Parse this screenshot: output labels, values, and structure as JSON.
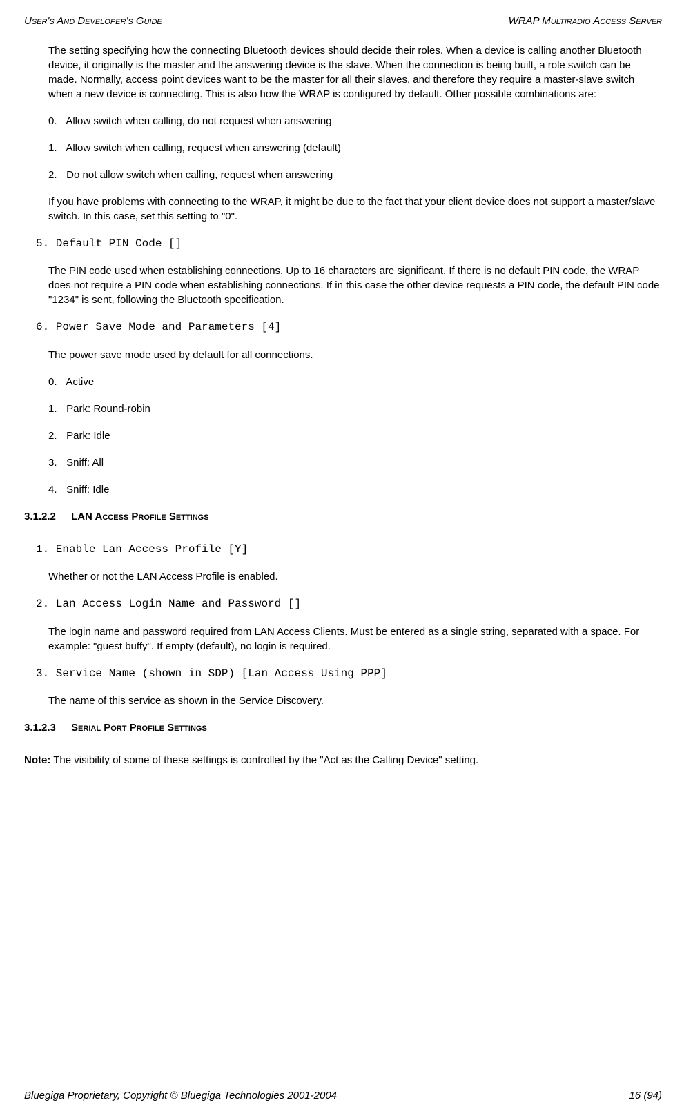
{
  "header": {
    "left": "User's And Developer's Guide",
    "right": "WRAP Multiradio Access Server"
  },
  "body": {
    "intro_para": "The setting specifying how the connecting Bluetooth devices should decide their roles. When a device is calling another Bluetooth device, it originally is the master and the answering device is the slave. When the connection is being built, a role switch can be made. Normally, access point devices want to be the master for all their slaves, and therefore they require a master-slave switch when a new device is connecting. This is also how the WRAP is configured by default. Other possible combinations are:",
    "role_items": [
      {
        "num": "0.",
        "text": "Allow switch when calling, do not request when answering"
      },
      {
        "num": "1.",
        "text": "Allow switch when calling, request when answering (default)"
      },
      {
        "num": "2.",
        "text": "Do not allow switch when calling, request when answering"
      }
    ],
    "role_note": "If you have problems with connecting to the WRAP, it might be due to the fact that your client device does not support a master/slave switch. In this case, set this setting to \"0\".",
    "item5_heading": "5. Default PIN Code []",
    "item5_text": "The PIN code used when establishing connections. Up to 16 characters are significant. If there is no default PIN code, the WRAP does not require a PIN code when establishing connections. If in this case the other device requests a PIN code, the default PIN code \"1234\" is sent, following the Bluetooth specification.",
    "item6_heading": "6. Power Save Mode and Parameters [4]",
    "item6_text": "The power save mode used by default for all connections.",
    "power_items": [
      {
        "num": "0.",
        "text": "Active"
      },
      {
        "num": "1.",
        "text": "Park: Round-robin"
      },
      {
        "num": "2.",
        "text": "Park: Idle"
      },
      {
        "num": "3.",
        "text": "Sniff: All"
      },
      {
        "num": "4.",
        "text": "Sniff: Idle"
      }
    ],
    "sec3122_num": "3.1.2.2",
    "sec3122_title": "LAN Access Profile Settings",
    "lan1_heading": "1. Enable Lan Access Profile [Y]",
    "lan1_text": "Whether or not the LAN Access Profile is enabled.",
    "lan2_heading": "2. Lan Access Login Name and Password []",
    "lan2_text": "The login name and password required from LAN Access Clients. Must be entered as a single string, separated with a space. For example: \"guest buffy\". If empty (default), no login is required.",
    "lan3_heading": "3. Service Name (shown in SDP) [Lan Access Using PPP]",
    "lan3_text": "The name of this service as shown in the Service Discovery.",
    "sec3123_num": "3.1.2.3",
    "sec3123_title": "Serial Port Profile Settings",
    "note_label": "Note:",
    "note_text": " The visibility of some of these settings is controlled by the \"Act as the Calling Device\" setting."
  },
  "footer": {
    "left": "Bluegiga Proprietary, Copyright © Bluegiga Technologies 2001-2004",
    "right": "16 (94)"
  }
}
